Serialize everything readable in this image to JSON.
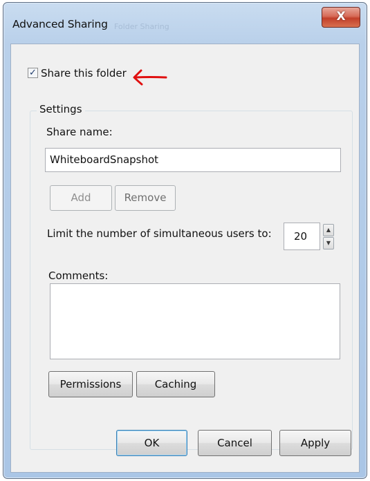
{
  "window": {
    "title": "Advanced Sharing",
    "ghost_title": "Folder Sharing",
    "close_glyph": "X"
  },
  "share_checkbox": {
    "checked": true,
    "check_glyph": "✓",
    "label": "Share this folder"
  },
  "annotation": {
    "arrow_color": "#e01010",
    "icon": "red-arrow-left"
  },
  "settings": {
    "legend": "Settings",
    "share_name_label": "Share name:",
    "share_name_value": "WhiteboardSnapshot",
    "add_label": "Add",
    "remove_label": "Remove",
    "limit_label": "Limit the number of simultaneous users to:",
    "limit_value": "20",
    "spin_up_glyph": "▲",
    "spin_down_glyph": "▼",
    "comments_label": "Comments:",
    "comments_value": "",
    "permissions_label": "Permissions",
    "caching_label": "Caching"
  },
  "footer": {
    "ok_label": "OK",
    "cancel_label": "Cancel",
    "apply_label": "Apply"
  }
}
